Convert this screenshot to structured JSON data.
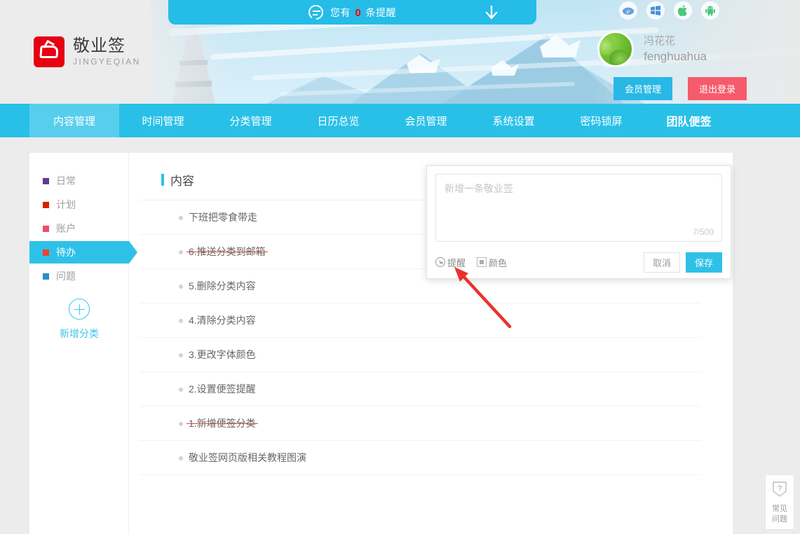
{
  "notify": {
    "icon": "speech-bubble-icon",
    "prefix": "您有",
    "count": "0",
    "suffix": "条提醒",
    "arrow_icon": "download-arrow-icon"
  },
  "brand": {
    "name": "敬业签",
    "pinyin": "JINGYEQIAN",
    "logo_color": "#e60012"
  },
  "platforms": [
    {
      "name": "ie-icon",
      "glyph": "e"
    },
    {
      "name": "windows-icon",
      "glyph": "⊞"
    },
    {
      "name": "apple-icon",
      "glyph": ""
    },
    {
      "name": "android-icon",
      "glyph": "🤖"
    }
  ],
  "account": {
    "nickname": "冯花花",
    "username": "fenghuahua",
    "vip_button": "会员管理",
    "logout_button": "退出登录",
    "vip_color": "#29b8e5",
    "logout_color": "#f55b6c"
  },
  "nav": {
    "accent": "#29c0e8",
    "items": [
      {
        "label": "内容管理",
        "active": true,
        "bold": false
      },
      {
        "label": "时间管理",
        "active": false,
        "bold": false
      },
      {
        "label": "分类管理",
        "active": false,
        "bold": false
      },
      {
        "label": "日历总览",
        "active": false,
        "bold": false
      },
      {
        "label": "会员管理",
        "active": false,
        "bold": false
      },
      {
        "label": "系统设置",
        "active": false,
        "bold": false
      },
      {
        "label": "密码锁屏",
        "active": false,
        "bold": false
      },
      {
        "label": "团队便签",
        "active": false,
        "bold": true
      }
    ]
  },
  "sidebar": {
    "categories": [
      {
        "label": "日常",
        "color": "#5d3a93",
        "active": false
      },
      {
        "label": "计划",
        "color": "#d82000",
        "active": false
      },
      {
        "label": "账户",
        "color": "#ed4c6e",
        "active": false
      },
      {
        "label": "待办",
        "color": "#f4412c",
        "active": true
      },
      {
        "label": "问题",
        "color": "#2b8fc4",
        "active": false
      }
    ],
    "add_category": {
      "label": "新增分类",
      "icon": "plus-circle-icon",
      "color": "#3bc6ea"
    }
  },
  "content": {
    "title": "内容",
    "notes": [
      {
        "text": "下班把零食带走",
        "done": false
      },
      {
        "text": "6.推送分类到邮箱",
        "done": true
      },
      {
        "text": "5.删除分类内容",
        "done": false
      },
      {
        "text": "4.清除分类内容",
        "done": false
      },
      {
        "text": "3.更改字体颜色",
        "done": false
      },
      {
        "text": "2.设置便签提醒",
        "done": false
      },
      {
        "text": "1.新增便签分类",
        "done": true
      },
      {
        "text": "敬业签网页版相关教程图演",
        "done": false
      }
    ]
  },
  "popup": {
    "placeholder": "新增一条敬业签",
    "value": "",
    "char_count": "7/500",
    "remind_label": "提醒",
    "remind_icon": "clock-icon",
    "color_label": "颜色",
    "color_icon": "color-square-icon",
    "cancel_label": "取消",
    "save_label": "保存",
    "save_color": "#2ec1e8"
  },
  "annotation": {
    "type": "red-arrow",
    "color": "#e8332a",
    "points_to": "remind-option"
  },
  "help": {
    "icon": "question-shield-icon",
    "line1": "常见",
    "line2": "问题"
  }
}
